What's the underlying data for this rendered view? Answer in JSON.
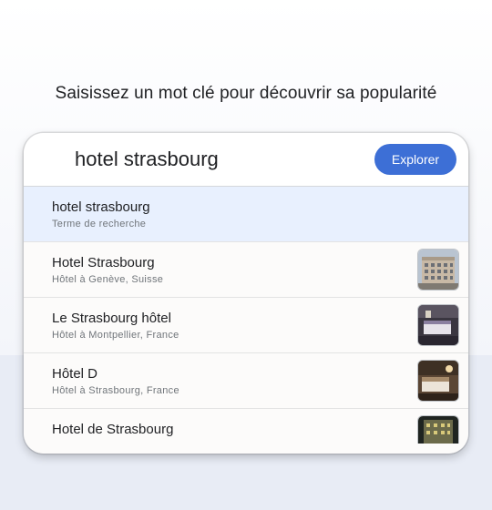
{
  "prompt_text": "Saisissez un mot clé pour découvrir sa popularité",
  "search": {
    "query": "hotel strasbourg",
    "button_label": "Explorer"
  },
  "results": [
    {
      "title": "hotel strasbourg",
      "subtitle": "Terme de recherche",
      "thumbnail": null
    },
    {
      "title": "Hotel Strasbourg",
      "subtitle": "Hôtel à Genève, Suisse",
      "thumbnail": "building-photo"
    },
    {
      "title": "Le Strasbourg hôtel",
      "subtitle": "Hôtel à Montpellier, France",
      "thumbnail": "room-photo"
    },
    {
      "title": "Hôtel D",
      "subtitle": "Hôtel à Strasbourg, France",
      "thumbnail": "bedroom-photo"
    },
    {
      "title": "Hotel de Strasbourg",
      "subtitle": "",
      "thumbnail": "night-facade-photo"
    }
  ],
  "colors": {
    "accent": "#3d6fd6",
    "highlight_row": "#e8f0fe"
  }
}
